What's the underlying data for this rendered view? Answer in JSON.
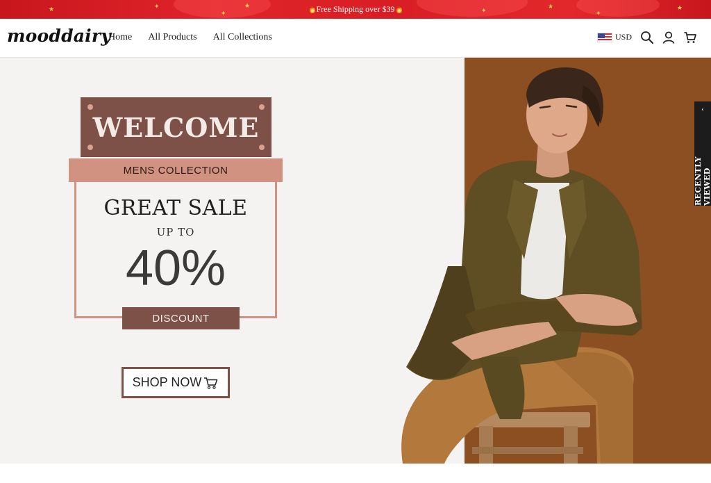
{
  "announcement": {
    "text": "Free Shipping over $39"
  },
  "header": {
    "logo": "mooddairy",
    "nav": [
      "Home",
      "All Products",
      "All Collections"
    ],
    "currency": "USD"
  },
  "hero": {
    "welcome": "WELCOME",
    "collection": "MENS COLLECTION",
    "sale_title": "GREAT SALE",
    "up_to": "UP TO",
    "percent": "40%",
    "discount": "DISCOUNT",
    "cta": "SHOP NOW"
  },
  "sidebar_tab": {
    "label": "RECENTLY VIEWED"
  },
  "colors": {
    "announcement_bg": "#d81e24",
    "accent_dark": "#7e5148",
    "accent_light": "#d29282",
    "hero_bg": "#f4f3f1",
    "hero_panel": "#8b4f22"
  },
  "icons": [
    "flame-icon",
    "us-flag-icon",
    "search-icon",
    "user-icon",
    "cart-icon",
    "chevron-left-icon"
  ]
}
